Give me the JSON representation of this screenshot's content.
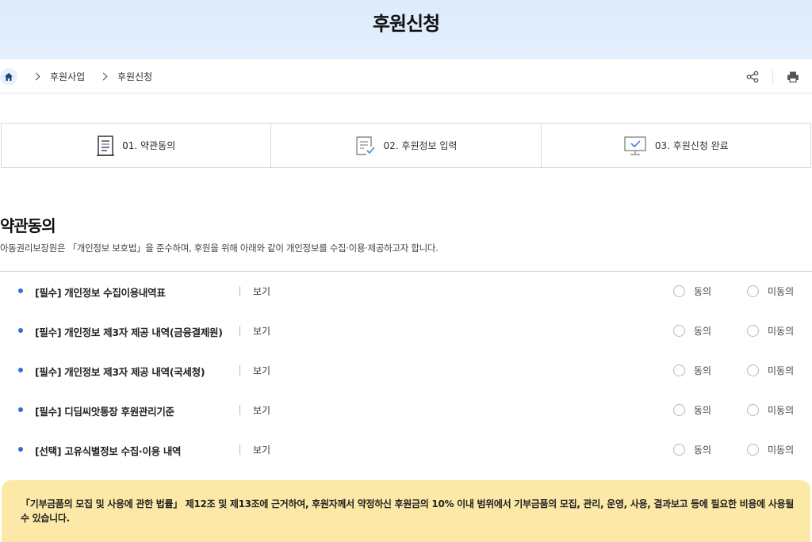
{
  "header": {
    "title": "후원신청"
  },
  "breadcrumb": {
    "items": [
      "후원사업",
      "후원신청"
    ]
  },
  "tools": {
    "share_icon": "share-icon",
    "print_icon": "print-icon"
  },
  "steps": [
    {
      "label": "01. 약관동의",
      "icon": "document-list-icon"
    },
    {
      "label": "02. 후원정보 입력",
      "icon": "form-check-icon"
    },
    {
      "label": "03. 후원신청 완료",
      "icon": "monitor-check-icon"
    }
  ],
  "section": {
    "title": "약관동의",
    "description": "아동권리보장원은 「개인정보 보호법」을 준수하며, 후원을 위해 아래와 같이 개인정보를 수집·이용·제공하고자 합니다."
  },
  "terms": [
    {
      "name": "[필수] 개인정보 수집이용내역표",
      "view": "보기",
      "agree": "동의",
      "disagree": "미동의"
    },
    {
      "name": "[필수] 개인정보 제3자 제공 내역(금융결제원)",
      "view": "보기",
      "agree": "동의",
      "disagree": "미동의"
    },
    {
      "name": "[필수] 개인정보 제3자 제공 내역(국세청)",
      "view": "보기",
      "agree": "동의",
      "disagree": "미동의"
    },
    {
      "name": "[필수] 디딤씨앗통장 후원관리기준",
      "view": "보기",
      "agree": "동의",
      "disagree": "미동의"
    },
    {
      "name": "[선택] 고유식별정보 수집·이용 내역",
      "view": "보기",
      "agree": "동의",
      "disagree": "미동의"
    }
  ],
  "notice": {
    "text": "「기부금품의 모집 및 사용에 관한 법률」 제12조 및 제13조에 근거하여, 후원자께서 약정하신 후원금의 10% 이내 범위에서 기부금품의 모집, 관리, 운영, 사용, 결과보고 등에 필요한 비용에 사용될 수 있습니다."
  },
  "colors": {
    "accent": "#2f6fd6",
    "hero_bg": "#dcebfb",
    "notice_bg": "#fde9a7"
  }
}
